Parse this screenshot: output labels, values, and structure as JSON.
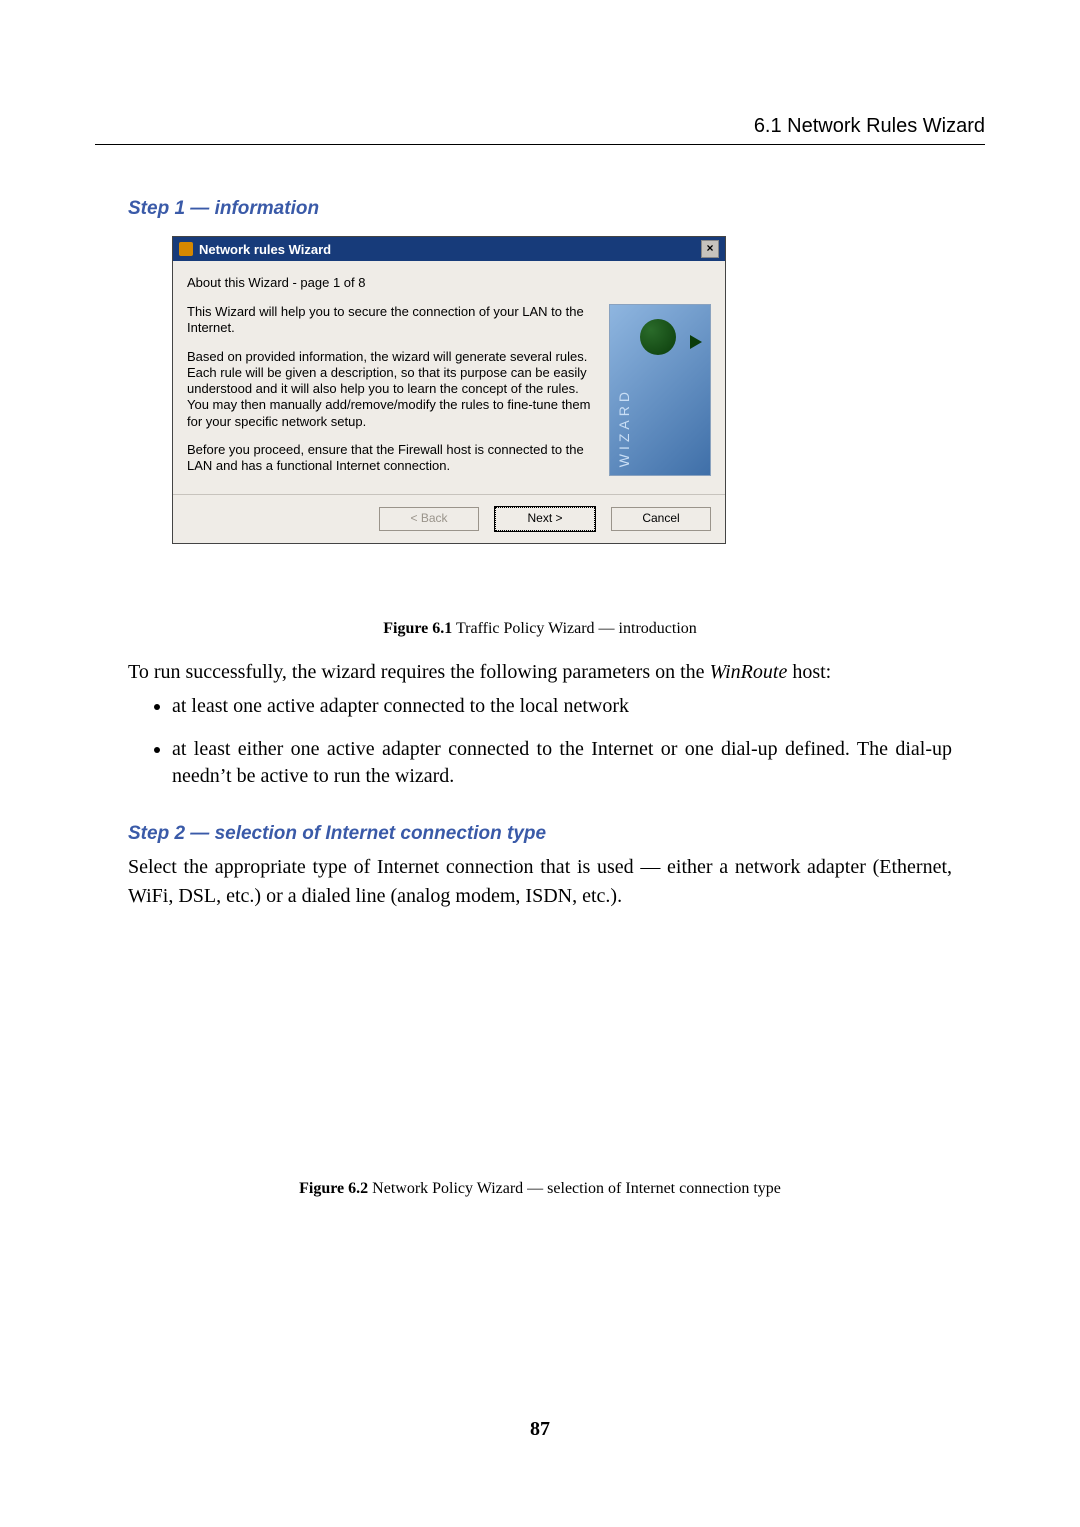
{
  "header": {
    "section": "6.1  Network Rules Wizard"
  },
  "step1_heading": "Step 1 — information",
  "dialog": {
    "title": "Network rules Wizard",
    "close_glyph": "×",
    "subtitle": "About this Wizard - page 1 of 8",
    "para1": "This Wizard will help you to secure the connection of your LAN to the Internet.",
    "para2": "Based on provided information, the wizard will generate several rules. Each rule will be given a description, so that its purpose can be easily understood and it will also help you to learn the concept of the rules. You may then manually add/remove/modify the rules to fine-tune them for your specific network setup.",
    "para3": "Before you proceed, ensure that the Firewall host is connected to the LAN and has a functional Internet connection.",
    "art_label": "WIZARD",
    "buttons": {
      "back": "< Back",
      "next": "Next >",
      "cancel": "Cancel"
    }
  },
  "fig1": {
    "label": "Figure 6.1",
    "text": "   Traffic Policy Wizard — introduction"
  },
  "intro_line_pre": "To run successfully, the wizard requires the following parameters on the ",
  "intro_line_em": "WinRoute",
  "intro_line_post": " host:",
  "bullets": {
    "b1": "at least one active adapter connected to the local network",
    "b2": "at least either one active adapter connected to the Internet or one dial-up defined. The dial-up needn’t be active to run the wizard."
  },
  "step2_heading": "Step 2 — selection of Internet connection type",
  "sel_para": "Select the appropriate type of Internet connection that is used — either a network adapter (Ethernet, WiFi, DSL, etc.) or a dialed line (analog modem, ISDN, etc.).",
  "fig2": {
    "label": "Figure 6.2",
    "text": "   Network Policy Wizard — selection of Internet connection type"
  },
  "page_number": "87"
}
